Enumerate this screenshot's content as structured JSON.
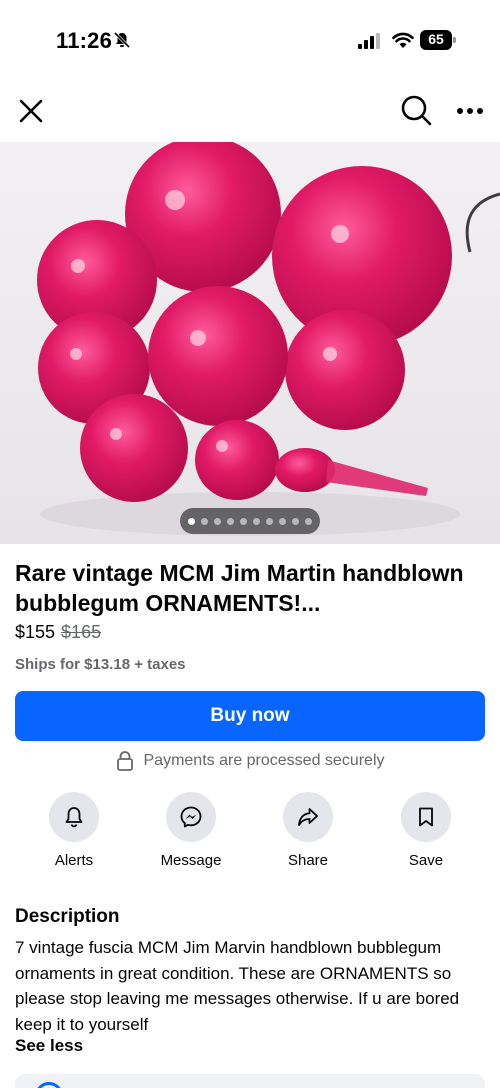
{
  "status_bar": {
    "time": "11:26",
    "battery": "65",
    "icons": [
      "bell-slash-icon",
      "cellular-signal-icon",
      "wifi-icon",
      "battery-icon"
    ]
  },
  "nav": {
    "icons": [
      "close-icon",
      "search-icon",
      "more-horizontal-icon"
    ]
  },
  "gallery": {
    "image_alt": "pink glass ornaments",
    "page_count": 10,
    "current_page": 1
  },
  "listing": {
    "title": "Rare vintage MCM Jim Martin handblown bubblegum ORNAMENTS!...",
    "price": "$155",
    "original_price": "$165",
    "shipping": "Ships for $13.18 + taxes"
  },
  "buy_button": {
    "label": "Buy now",
    "color": "#0866ff"
  },
  "secure_note": {
    "text": "Payments are processed securely",
    "icon": "lock-icon"
  },
  "actions": [
    {
      "label": "Alerts",
      "icon": "bell-icon"
    },
    {
      "label": "Message",
      "icon": "messenger-icon"
    },
    {
      "label": "Share",
      "icon": "share-icon"
    },
    {
      "label": "Save",
      "icon": "bookmark-icon"
    }
  ],
  "description": {
    "heading": "Description",
    "body": "7 vintage fuscia MCM Jim Marvin handblown bubblegum ornaments in great condition. These are ORNAMENTS so please stop leaving me messages otherwise. If u are bored keep it to yourself",
    "toggle_label": "See less"
  },
  "colors": {
    "accent": "#0866ff",
    "secondary_text": "#65676b",
    "ornament": "#d8145e"
  }
}
